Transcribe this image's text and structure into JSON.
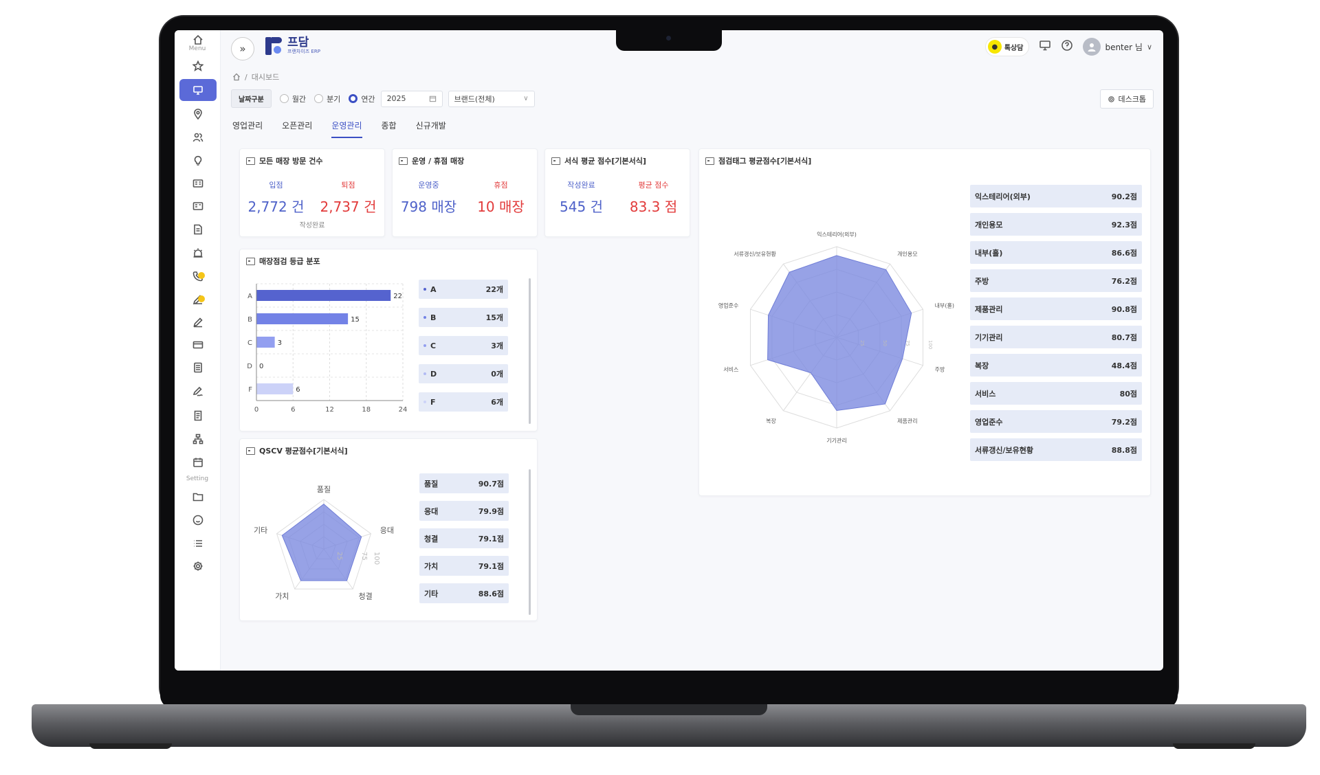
{
  "sidebar": {
    "menu_label": "Menu",
    "setting_label": "Setting",
    "items": [
      "home-icon",
      "star-icon",
      "monitor-icon",
      "map-pin-icon",
      "users-icon",
      "bulb-icon",
      "id-card-icon",
      "id-card-icon",
      "document-icon",
      "alarm-icon",
      "phone-icon",
      "pen-icon",
      "edit-icon",
      "card-icon",
      "list-doc-icon",
      "sign-icon",
      "receipt-icon",
      "org-chart-icon",
      "calendar-icon",
      "folder-icon",
      "smile-icon",
      "list-icon",
      "gear-icon"
    ]
  },
  "header": {
    "logo_title": "프담",
    "logo_sub": "프랜차이즈 ERP",
    "kakao_label": "톡상담",
    "user_name": "benter 님"
  },
  "breadcrumb": {
    "current": "대시보드"
  },
  "filter": {
    "label": "날짜구분",
    "options": [
      "월간",
      "분기",
      "연간"
    ],
    "selected": "연간",
    "year": "2025",
    "brand": "브랜드(전체)"
  },
  "desk_button": "데스크톱",
  "tabs": [
    "영업관리",
    "오픈관리",
    "운영관리",
    "종합",
    "신규개발"
  ],
  "active_tab": "운영관리",
  "cards": {
    "visits": {
      "title": "모든 매장 방문 건수",
      "in_label": "입점",
      "in_value": "2,772 건",
      "out_label": "퇴점",
      "out_value": "2,737 건",
      "footer": "작성완료"
    },
    "operation": {
      "title": "운영 / 휴점 매장",
      "open_label": "운영중",
      "open_value": "798 매장",
      "closed_label": "휴점",
      "closed_value": "10 매장"
    },
    "form_avg": {
      "title": "서식 평균 점수[기본서식]",
      "done_label": "작성완료",
      "done_value": "545 건",
      "avg_label": "평균 점수",
      "avg_value": "83.3 점"
    },
    "grade": {
      "title": "매장점검 등급 분포"
    },
    "qscv": {
      "title": "QSCV 평균점수[기본서식]"
    },
    "tags": {
      "title": "점검태그 평균점수[기본서식]"
    }
  },
  "chart_data": [
    {
      "type": "bar",
      "orientation": "horizontal",
      "title": "매장점검 등급 분포",
      "categories": [
        "A",
        "B",
        "C",
        "D",
        "F"
      ],
      "values": [
        22,
        15,
        3,
        0,
        6
      ],
      "xlim": [
        0,
        24
      ],
      "xticks": [
        "0",
        "6",
        "12",
        "18",
        "24"
      ],
      "colors": [
        "#5563cf",
        "#7382e6",
        "#939ff0",
        "#b2bbf4",
        "#ccd2f8"
      ],
      "legend": [
        {
          "label": "A",
          "value": "22개"
        },
        {
          "label": "B",
          "value": "15개"
        },
        {
          "label": "C",
          "value": "3개"
        },
        {
          "label": "D",
          "value": "0개"
        },
        {
          "label": "F",
          "value": "6개"
        }
      ]
    },
    {
      "type": "radar",
      "title": "QSCV 평균점수[기본서식]",
      "categories": [
        "품질",
        "응대",
        "청결",
        "가치",
        "기타"
      ],
      "values": [
        90.7,
        79.9,
        79.1,
        79.1,
        88.6
      ],
      "range": [
        0,
        100
      ],
      "ticks": [
        "25",
        "75",
        "100"
      ],
      "color": "#7a88df",
      "list": [
        {
          "label": "품질",
          "value": "90.7점"
        },
        {
          "label": "응대",
          "value": "79.9점"
        },
        {
          "label": "청결",
          "value": "79.1점"
        },
        {
          "label": "가치",
          "value": "79.1점"
        },
        {
          "label": "기타",
          "value": "88.6점"
        }
      ]
    },
    {
      "type": "radar",
      "title": "점검태그 평균점수[기본서식]",
      "categories": [
        "익스테리어(외부)",
        "개인용모",
        "내부(홀)",
        "주방",
        "제품관리",
        "기기관리",
        "복장",
        "서비스",
        "영업준수",
        "서류갱신/보유현황"
      ],
      "values": [
        90.2,
        92.3,
        86.6,
        76.2,
        90.8,
        80.7,
        48.4,
        80,
        79.2,
        88.8
      ],
      "range": [
        0,
        100
      ],
      "ticks": [
        "25",
        "50",
        "75",
        "100"
      ],
      "color": "#7a88df",
      "list": [
        {
          "label": "익스테리어(외부)",
          "value": "90.2점"
        },
        {
          "label": "개인용모",
          "value": "92.3점"
        },
        {
          "label": "내부(홀)",
          "value": "86.6점"
        },
        {
          "label": "주방",
          "value": "76.2점"
        },
        {
          "label": "제품관리",
          "value": "90.8점"
        },
        {
          "label": "기기관리",
          "value": "80.7점"
        },
        {
          "label": "복장",
          "value": "48.4점"
        },
        {
          "label": "서비스",
          "value": "80점"
        },
        {
          "label": "영업준수",
          "value": "79.2점"
        },
        {
          "label": "서류갱신/보유현황",
          "value": "88.8점"
        }
      ]
    }
  ]
}
